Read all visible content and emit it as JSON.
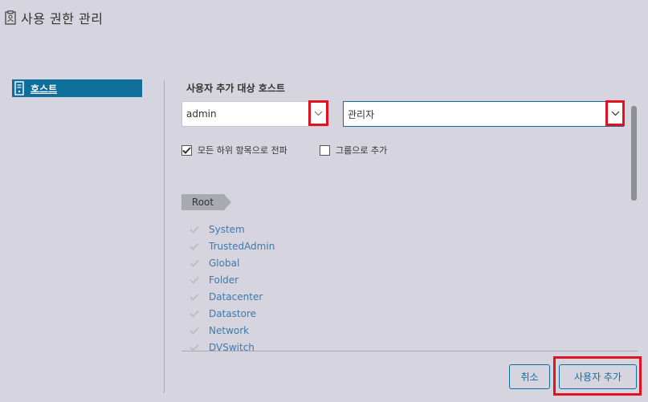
{
  "window": {
    "title": "사용 권한 관리"
  },
  "sidebar": {
    "items": [
      {
        "label": "호스트"
      }
    ]
  },
  "form": {
    "section_title": "사용자 추가 대상 호스트",
    "user_select_value": "admin",
    "role_select_value": "관리자",
    "propagate_label": "모든 하위 항목으로 전파",
    "propagate_checked": true,
    "add_as_group_label": "그룹으로 추가",
    "add_as_group_checked": false
  },
  "privileges": {
    "root_label": "Root",
    "items": [
      "System",
      "TrustedAdmin",
      "Global",
      "Folder",
      "Datacenter",
      "Datastore",
      "Network",
      "DVSwitch"
    ]
  },
  "buttons": {
    "cancel": "취소",
    "add_user": "사용자 추가"
  },
  "colors": {
    "accent": "#0f6f9c",
    "highlight": "#e0121f",
    "background": "#d6d5df"
  }
}
